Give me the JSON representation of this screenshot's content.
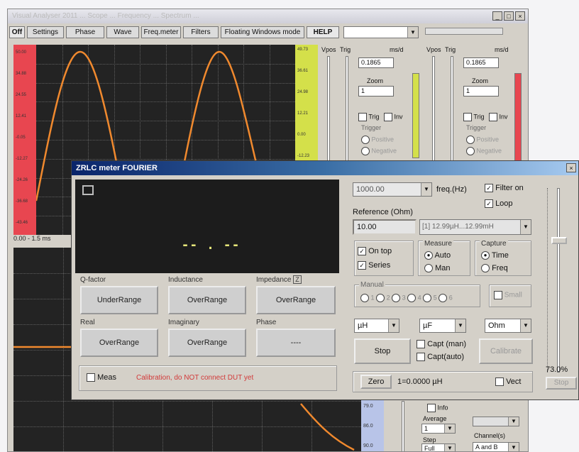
{
  "main": {
    "title": "Visual Analyser 2011 ... Scope ... Frequency ... Spectrum ...",
    "tabs": [
      "Off",
      "Settings",
      "Phase",
      "Wave",
      "Freq.meter",
      "Filters",
      "Floating Windows mode",
      "HELP"
    ],
    "left_scale": [
      "50.00",
      "34.88",
      "24.55",
      "12.41",
      "-0.05",
      "-12.27",
      "-24.26",
      "-36.68",
      "-43.46"
    ],
    "right_scale": [
      "49.73",
      "36.61",
      "24.98",
      "12.21",
      "0.00",
      "-12.23"
    ],
    "time_label": "0.00 - 1.5 ms",
    "bottom_scale": [
      "79.0",
      "86.0",
      "90.0"
    ],
    "ch_a": {
      "vpos": "Vpos",
      "trig": "Trig",
      "unit": "ms/d",
      "value": "0.1865",
      "zoom_label": "Zoom",
      "zoom_value": "1",
      "trig_cb": "Trig",
      "inv_cb": "Inv",
      "trigger_group": "Trigger",
      "trigger_opts": [
        "Positive",
        "Negative"
      ]
    },
    "ch_b": {
      "vpos": "Vpos",
      "trig": "Trig",
      "unit": "ms/d",
      "value": "0.1865",
      "zoom_label": "Zoom",
      "zoom_value": "1",
      "trig_cb": "Trig",
      "inv_cb": "Inv",
      "trigger_group": "Trigger",
      "trigger_opts": [
        "Positive",
        "Negative"
      ]
    },
    "lower": {
      "info_label": "Info",
      "average_label": "Average",
      "average_value": "1",
      "step_label": "Step",
      "step_value": "Full",
      "channels_label": "Channel(s)",
      "channels_value": "A and B"
    }
  },
  "dialog": {
    "title": "ZRLC meter FOURIER",
    "display_value": "-- . --",
    "fields": {
      "q_factor": {
        "label": "Q-factor",
        "value": "UnderRange"
      },
      "inductance": {
        "label": "Inductance",
        "value": "OverRange"
      },
      "impedance": {
        "label": "Impedance",
        "badge": "Z",
        "value": "OverRange"
      },
      "real": {
        "label": "Real",
        "value": "OverRange"
      },
      "imaginary": {
        "label": "Imaginary",
        "value": "OverRange"
      },
      "phase": {
        "label": "Phase",
        "value": "----"
      }
    },
    "meas_label": "Meas",
    "calibration_msg": "Calibration, do NOT connect DUT yet",
    "freq_value": "1000.00",
    "freq_label": "freq.(Hz)",
    "filter_on": "Filter on",
    "loop": "Loop",
    "reference_label": "Reference (Ohm)",
    "reference_value": "10.00",
    "range_value": "[1] 12.99µH...12.99mH",
    "on_top": "On top",
    "series": "Series",
    "measure_group": "Measure",
    "measure_opts": [
      "Auto",
      "Man"
    ],
    "capture_group": "Capture",
    "capture_opts": [
      "Time",
      "Freq"
    ],
    "manual_group": "Manual",
    "manual_opts": [
      "1",
      "2",
      "3",
      "4",
      "5",
      "6"
    ],
    "small_label": "Small",
    "unit1": "µH",
    "unit2": "µF",
    "unit3": "Ohm",
    "stop_btn": "Stop",
    "capt_man": "Capt (man)",
    "capt_auto": "Capt(auto)",
    "calibrate_btn": "Calibrate",
    "zero_btn": "Zero",
    "readout": "1=0.0000 µH",
    "vect": "Vect",
    "slider_pct": "73.0%",
    "side_btn": "Stop",
    "slider_level": 0.73
  },
  "colors": {
    "trace": "#f0892e",
    "scale_red": "#e84650",
    "scale_yellow": "#d4e04a",
    "scale_blue": "#b8c4e8",
    "display_bg": "#1c1c1c",
    "digit": "#e6e67a",
    "warning": "#d23a3a",
    "titlebar": "#0a246a"
  }
}
